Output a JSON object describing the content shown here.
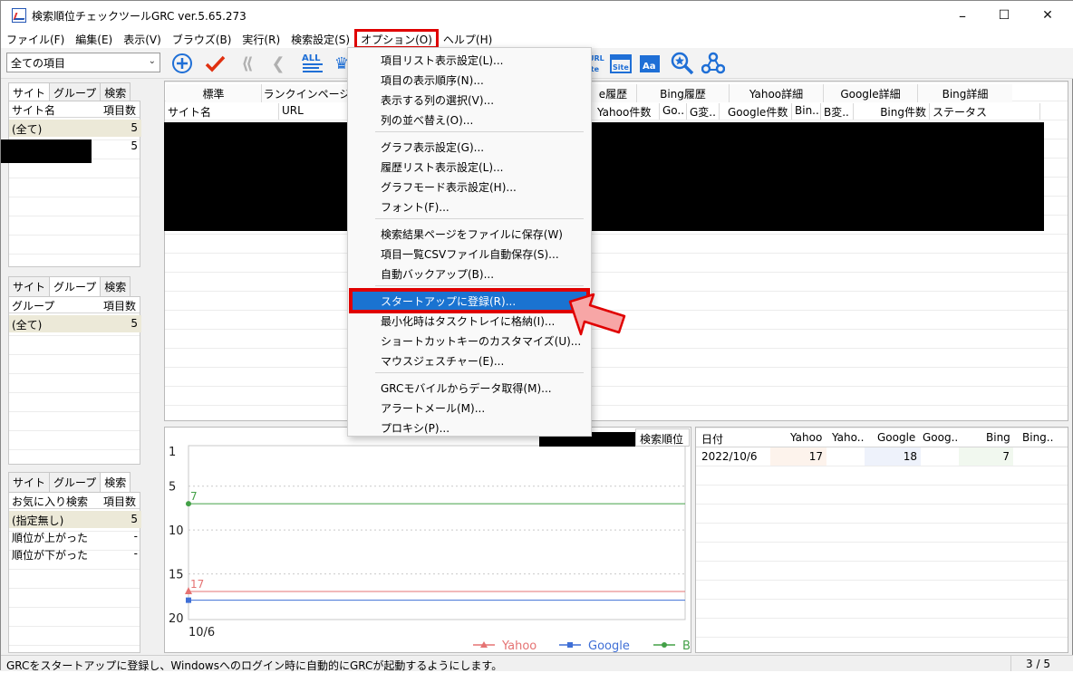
{
  "window": {
    "title": "検索順位チェックツールGRC  ver.5.65.273",
    "minimize": "–",
    "maximize": "☐",
    "close": "✕"
  },
  "menubar": [
    "ファイル(F)",
    "編集(E)",
    "表示(V)",
    "ブラウズ(B)",
    "実行(R)",
    "検索設定(S)",
    "オプション(O)",
    "ヘルプ(H)"
  ],
  "toolbar": {
    "combo_value": "全ての項目",
    "all_label": "ALL",
    "url_label": "URL",
    "site_label": "Site",
    "aa_label": "Aa"
  },
  "left_panel_1": {
    "tabs": [
      "サイト",
      "グループ",
      "検索"
    ],
    "headers": [
      "サイト名",
      "項目数"
    ],
    "rows": [
      {
        "name": "(全て)",
        "count": "5"
      },
      {
        "name": "",
        "count": "5"
      }
    ]
  },
  "left_panel_2": {
    "tabs": [
      "サイト",
      "グループ",
      "検索"
    ],
    "headers": [
      "グループ",
      "項目数"
    ],
    "rows": [
      {
        "name": "(全て)",
        "count": "5"
      }
    ]
  },
  "left_panel_3": {
    "tabs": [
      "サイト",
      "グループ",
      "検索"
    ],
    "headers": [
      "お気に入り検索",
      "項目数"
    ],
    "rows": [
      {
        "name": "(指定無し)",
        "count": "5"
      },
      {
        "name": "順位が上がった",
        "count": "-"
      },
      {
        "name": "順位が下がった",
        "count": "-"
      }
    ]
  },
  "main_table": {
    "tabs": [
      "標準",
      "ランクインページ",
      "e履歴",
      "Bing履歴",
      "Yahoo詳細",
      "Google詳細",
      "Bing詳細"
    ],
    "headers_left": [
      "サイト名",
      "URL"
    ],
    "headers_right": [
      "Yahoo件数",
      "Go..",
      "G変..",
      "Google件数",
      "Bin..",
      "B変..",
      "Bing件数",
      "ステータス"
    ]
  },
  "options_menu": {
    "group1": [
      "項目リスト表示設定(L)...",
      "項目の表示順序(N)...",
      "表示する列の選択(V)...",
      "列の並べ替え(O)..."
    ],
    "group2": [
      "グラフ表示設定(G)...",
      "履歴リスト表示設定(L)...",
      "グラフモード表示設定(H)...",
      "フォント(F)..."
    ],
    "group3": [
      "検索結果ページをファイルに保存(W)",
      "項目一覧CSVファイル自動保存(S)...",
      "自動バックアップ(B)..."
    ],
    "highlighted": "スタートアップに登録(R)...",
    "group4": [
      "最小化時はタスクトレイに格納(I)...",
      "ショートカットキーのカスタマイズ(U)...",
      "マウスジェスチャー(E)..."
    ],
    "group5": [
      "GRCモバイルからデータ取得(M)...",
      "アラートメール(M)...",
      "プロキシ(P)..."
    ]
  },
  "chart_data": {
    "type": "line",
    "title": "検索順位",
    "x": [
      "10/6"
    ],
    "y_ticks": [
      "1",
      "5",
      "10",
      "15",
      "20"
    ],
    "ylim": [
      20,
      1
    ],
    "series": [
      {
        "name": "Yahoo",
        "values": [
          17
        ],
        "color": "#e57373",
        "marker": "triangle"
      },
      {
        "name": "Google",
        "values": [
          18
        ],
        "color": "#3f6fd6",
        "marker": "square"
      },
      {
        "name": "Bing",
        "values": [
          7
        ],
        "color": "#43a047",
        "marker": "circle"
      }
    ],
    "data_labels": {
      "yahoo": "17",
      "bing": "7"
    },
    "legend": "bottom-right"
  },
  "history_table": {
    "headers": [
      "日付",
      "Yahoo",
      "Yaho..",
      "Google",
      "Goog..",
      "Bing",
      "Bing.."
    ],
    "rows": [
      {
        "date": "2022/10/6",
        "yahoo": "17",
        "google": "18",
        "bing": "7"
      }
    ]
  },
  "statusbar": {
    "message": "GRCをスタートアップに登録し、Windowsへのログイン時に自動的にGRCが起動するようにします。",
    "page": "3 / 5"
  }
}
